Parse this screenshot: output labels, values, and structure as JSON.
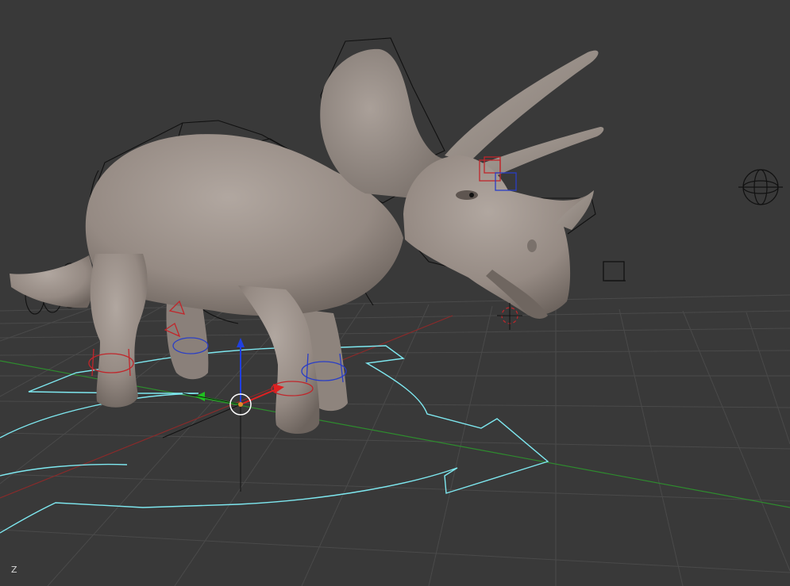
{
  "viewport": {
    "background": "#393939",
    "grid_color": "#4a4a4a",
    "x_axis_color": "#8b2a2a",
    "y_axis_color": "#2e8b2e"
  },
  "model": {
    "body_color": "#9a8f88",
    "shadow_color": "#6f6660",
    "rig_line_color": "#111111"
  },
  "controls": {
    "root_control_color": "#7ee8f0",
    "left_control_color": "#c0262b",
    "right_control_color": "#2a3ec6",
    "widget_x_color": "#e02020",
    "widget_y_color": "#20c020",
    "widget_z_color": "#2040e0"
  },
  "axis_indicator": {
    "label": "Z",
    "color": "#d8d8d8"
  }
}
